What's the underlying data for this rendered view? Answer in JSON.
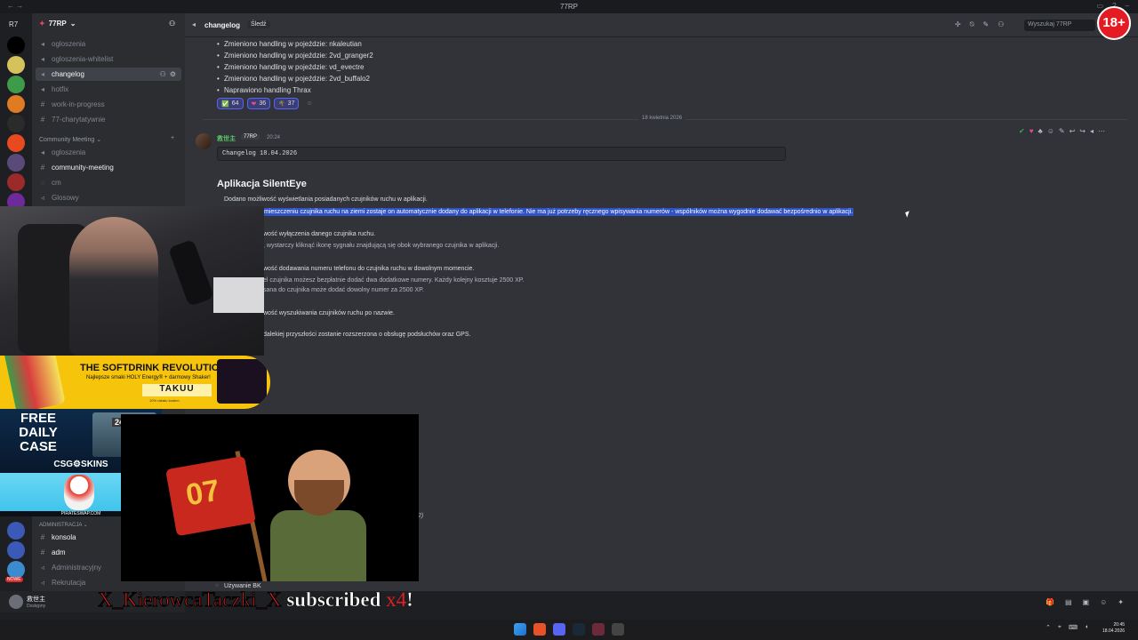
{
  "window": {
    "title": "77RP",
    "nav": "← →"
  },
  "server": {
    "name": "77RP",
    "rail_label": "R7"
  },
  "sidebar": {
    "channels_top": [
      {
        "label": "ogloszenia"
      },
      {
        "label": "ogloszenia-whitelist"
      },
      {
        "label": "changelog"
      },
      {
        "label": "hotfix"
      },
      {
        "label": "work-in-progress"
      },
      {
        "label": "77-charytatywnie"
      }
    ],
    "category": "Community Meeting",
    "channels_meeting": [
      {
        "label": "ogloszenia"
      },
      {
        "label": "community-meeting"
      },
      {
        "label": "cm"
      },
      {
        "label": "Glosowy"
      }
    ],
    "admin_category": "ADMINISTRACJA",
    "channels_admin": [
      {
        "label": "konsola"
      },
      {
        "label": "adm"
      },
      {
        "label": "Administracyjny"
      },
      {
        "label": "Rekrutacja"
      }
    ],
    "voice_status": "Używanie BK"
  },
  "header": {
    "channel": "changelog",
    "follow": "Śledź",
    "search_placeholder": "Wyszukaj 77RP"
  },
  "messages": {
    "prev_bullets": [
      "Zmieniono handling w pojeździe: nkaleutian",
      "Zmieniono handling w pojeździe: 2vd_granger2",
      "Zmieniono handling w pojeździe: vd_evectre",
      "Zmieniono handling w pojeździe: 2vd_buffalo2",
      "Naprawiono handling Thrax"
    ],
    "reactions": [
      {
        "emoji": "✅",
        "count": "64"
      },
      {
        "emoji": "❤",
        "count": "36"
      },
      {
        "emoji": "🌴",
        "count": "37"
      }
    ],
    "date_divider": "18 kwietnia 2026",
    "author": "救世主",
    "author_tag": "77RP",
    "time": "20:24",
    "code": "Changelog 18.04.2026",
    "heading": "Aplikacja SilentEye",
    "lines": {
      "l1": "Dodano możliwość wyświetlania posiadanych czujników ruchu w aplikacji.",
      "l2": "mieszczeniu czujnika ruchu na ziemi zostaje on automatycznie dodany do aplikacji w telefonie. Nie ma już potrzeby ręcznego wpisywania numerów - wspólników można wygodnie dodawać bezpośrednio w aplikacji.",
      "l3": "wość wyłączenia danego czujnika ruchu.",
      "l4": ", wystarczy kliknąć ikonę sygnału znajdującą się obok wybranego czujnika w aplikacji.",
      "l5": "wość dodawania numeru telefonu do czujnika ruchu w dowolnym momencie.",
      "l6": "el czujnika możesz bezpłatnie dodać dwa dodatkowe numery. Każdy kolejny kosztuje 2500 XP.",
      "l7": "sana do czujnika może dodać dowolny numer za 2500 XP.",
      "l8": "wość wyszukiwania czujników ruchu po nazwie.",
      "l9": "dalekiej przyszłości zostanie rozszerzona o obsługę podsłuchów oraz GPS.",
      "l10": "2)"
    }
  },
  "promo": {
    "headline": "THE SOFTDRINK REVOLUTION",
    "sub": "Najlepsze smaki HOLY Energy® + darmowy Shaker!",
    "brand": "TAKUU",
    "fine": "10% rabatu kodem"
  },
  "case_ad": {
    "free": "FREE DAILY CASE",
    "badge": "24H",
    "brand": "CSG⚙SKINS"
  },
  "pirate_ad": {
    "brand": "PIRATESWAP.COM"
  },
  "mascot": {
    "flag_text": "07"
  },
  "user": {
    "name": "救世主",
    "status": "Dostępny"
  },
  "alert": {
    "name": "X_KierowcaTaczki_X",
    "msg": "subscribed",
    "count": "x4",
    "bang": "!"
  },
  "badge": "18+",
  "clock": {
    "time": "20:45",
    "date": "18.04.2026"
  },
  "new_badge": "NOWE"
}
